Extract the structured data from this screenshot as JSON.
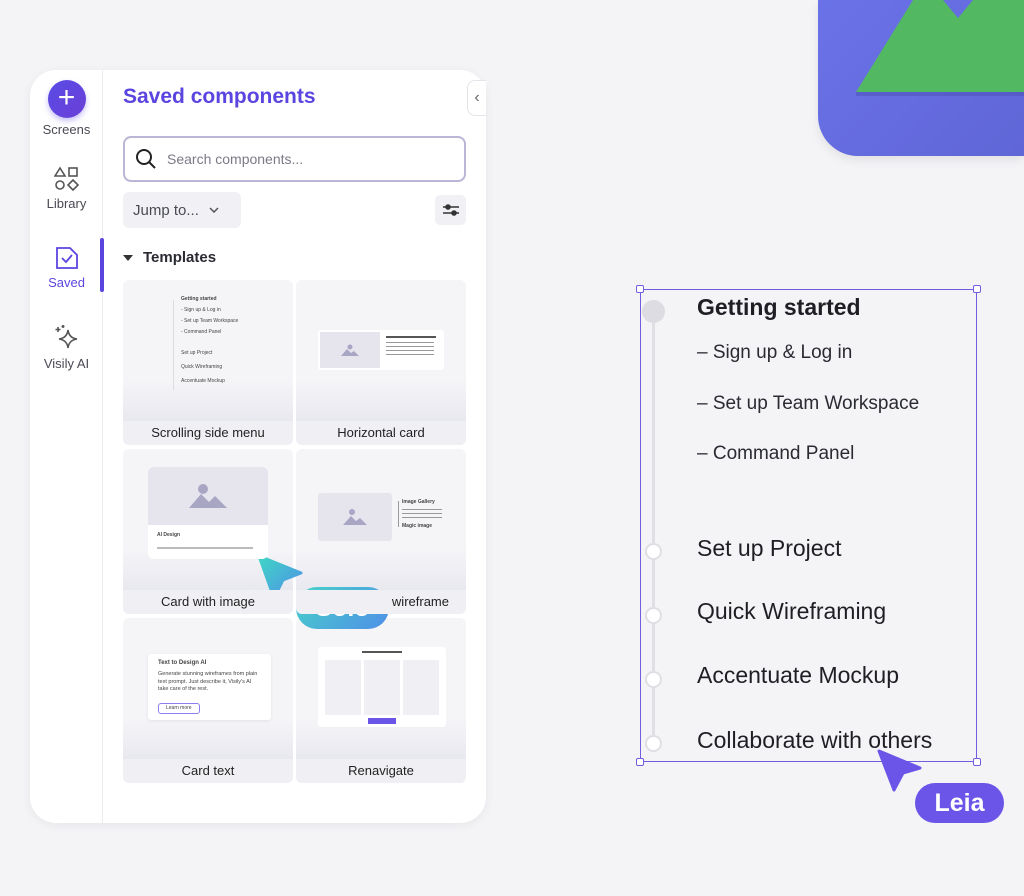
{
  "colors": {
    "accent": "#5b45e0",
    "app_icon_bg": "#6b72e8",
    "mountain": "#52b862",
    "solo": "#4fb0e8",
    "leia": "#6a55e8"
  },
  "rail": [
    {
      "icon": "plus-icon",
      "label": "Screens"
    },
    {
      "icon": "shapes-icon",
      "label": "Library"
    },
    {
      "icon": "saved-icon",
      "label": "Saved",
      "active": true
    },
    {
      "icon": "sparkle-icon",
      "label": "Visily AI"
    }
  ],
  "panel": {
    "title": "Saved components",
    "search_placeholder": "Search components...",
    "jump_label": "Jump to...",
    "section": "Templates"
  },
  "cards": [
    {
      "label": "Scrolling side menu",
      "preview": {
        "title": "Getting started",
        "subs": [
          "- Sign up & Log in",
          "- Set up Team Workspace",
          "- Command Panel"
        ],
        "steps": [
          "Set up Project",
          "Quick Wireframing",
          "Accentuate Mockup"
        ]
      }
    },
    {
      "label": "Horizontal card"
    },
    {
      "label": "Card with image",
      "preview": {
        "title": "AI Design"
      }
    },
    {
      "label": "wireframe",
      "preview": {
        "title": "Image Gallery",
        "sub": "Magic image"
      }
    },
    {
      "label": "Card text",
      "preview": {
        "title": "Text to Design AI",
        "body": "Generate stunning wireframes from plain text prompt. Just describe it, Visily's AI take care of the rest.",
        "button": "Learn more"
      }
    },
    {
      "label": "Renavigate"
    }
  ],
  "cursors": [
    {
      "name": "Solo"
    },
    {
      "name": "Leia"
    }
  ],
  "canvas": {
    "title": "Getting started",
    "subs": [
      "– Sign up & Log in",
      "– Set up Team Workspace",
      "– Command Panel"
    ],
    "steps": [
      "Set up Project",
      "Quick Wireframing",
      "Accentuate Mockup",
      "Collaborate with others"
    ]
  }
}
